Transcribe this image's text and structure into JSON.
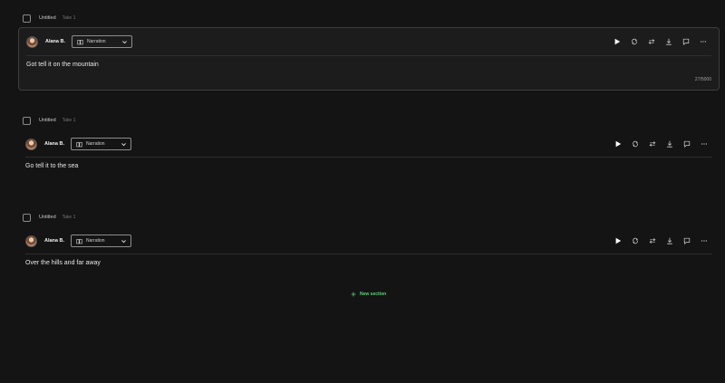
{
  "sections": [
    {
      "title": "Untitled",
      "take": "Take 1",
      "voice": "Alana B.",
      "style": "Narration",
      "text": "Got tell it on the mountain",
      "char_count": "27/5000"
    },
    {
      "title": "Untitled",
      "take": "Take 1",
      "voice": "Alana B.",
      "style": "Narration",
      "text": "Go tell it to the sea"
    },
    {
      "title": "Untitled",
      "take": "Take 1",
      "voice": "Alana B.",
      "style": "Narration",
      "text": "Over the hills and far away"
    }
  ],
  "new_section_label": "New section",
  "colors": {
    "background": "#141414",
    "accent_green": "#5ed07a",
    "card_border": "#3e3e40"
  },
  "icons": {
    "style": "book-icon",
    "dropdown": "chevron-down-icon",
    "toolbar": [
      "play-icon",
      "regenerate-icon",
      "swap-icon",
      "download-icon",
      "comment-icon",
      "more-icon"
    ],
    "new_section": "plus-icon"
  }
}
